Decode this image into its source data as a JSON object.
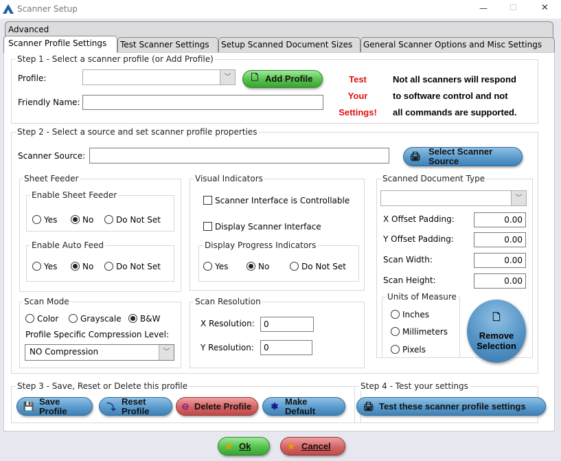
{
  "window": {
    "title": "Scanner Setup",
    "minimize": "—",
    "maximize": "☐",
    "close": "✕"
  },
  "tabs": {
    "advanced": "Advanced",
    "items": [
      "Scanner Profile Settings",
      "Test Scanner Settings",
      "Setup Scanned Document Sizes",
      "General Scanner Options and Misc Settings"
    ],
    "selected": "Scanner Profile Settings"
  },
  "step1": {
    "legend": "Step 1 - Select a scanner profile (or Add Profile)",
    "profile_label": "Profile:",
    "profile_value": "",
    "add_profile": "Add Profile",
    "friendly_label": "Friendly Name:",
    "friendly_value": "",
    "test_lines": [
      "Test",
      "Your",
      "Settings!"
    ],
    "note_lines": [
      "Not all scanners will respond",
      "to software control and not",
      "all commands are supported."
    ]
  },
  "step2": {
    "legend": "Step 2 - Select a source and set scanner profile properties",
    "source_label": "Scanner Source:",
    "source_value": "",
    "select_source": [
      "Select Scanner",
      "Source"
    ],
    "sheet_feeder": {
      "legend": "Sheet Feeder",
      "enable_sheet": {
        "legend": "Enable Sheet Feeder",
        "options": [
          "Yes",
          "No",
          "Do Not Set"
        ],
        "selected": "No"
      },
      "auto_feed": {
        "legend": "Enable Auto Feed",
        "options": [
          "Yes",
          "No",
          "Do Not Set"
        ],
        "selected": "No"
      }
    },
    "visual": {
      "legend": "Visual Indicators",
      "controllable": "Scanner Interface is Controllable",
      "controllable_checked": false,
      "display_interface": "Display Scanner Interface",
      "display_checked": false,
      "progress": {
        "legend": "Display Progress Indicators",
        "options": [
          "Yes",
          "No",
          "Do Not Set"
        ],
        "selected": "No"
      }
    },
    "scan_mode": {
      "legend": "Scan Mode",
      "options": [
        "Color",
        "Grayscale",
        "B&W"
      ],
      "selected": "B&W",
      "compression_label": "Profile Specific Compression Level:",
      "compression_value": "NO Compression"
    },
    "resolution": {
      "legend": "Scan Resolution",
      "x_label": "X Resolution:",
      "x_value": "0",
      "y_label": "Y Resolution:",
      "y_value": "0"
    },
    "doc_type": {
      "legend": "Scanned Document Type",
      "value": "",
      "x_offset_label": "X Offset Padding:",
      "x_offset": "0.00",
      "y_offset_label": "Y Offset Padding:",
      "y_offset": "0.00",
      "width_label": "Scan Width:",
      "width": "0.00",
      "height_label": "Scan Height:",
      "height": "0.00",
      "units": {
        "legend": "Units of Measure",
        "options": [
          "Inches",
          "Millimeters",
          "Pixels"
        ]
      },
      "remove": [
        "Remove",
        "Selection"
      ]
    }
  },
  "step3": {
    "legend": "Step 3 - Save, Reset or Delete this profile",
    "save": [
      "Save",
      "Profile"
    ],
    "reset": [
      "Reset",
      "Profile"
    ],
    "delete": "Delete Profile",
    "make_default": [
      "Make",
      "Default"
    ]
  },
  "step4": {
    "legend": "Step 4 - Test your settings",
    "test": "Test these scanner profile settings"
  },
  "footer": {
    "ok": "Ok",
    "cancel": "Cancel"
  }
}
